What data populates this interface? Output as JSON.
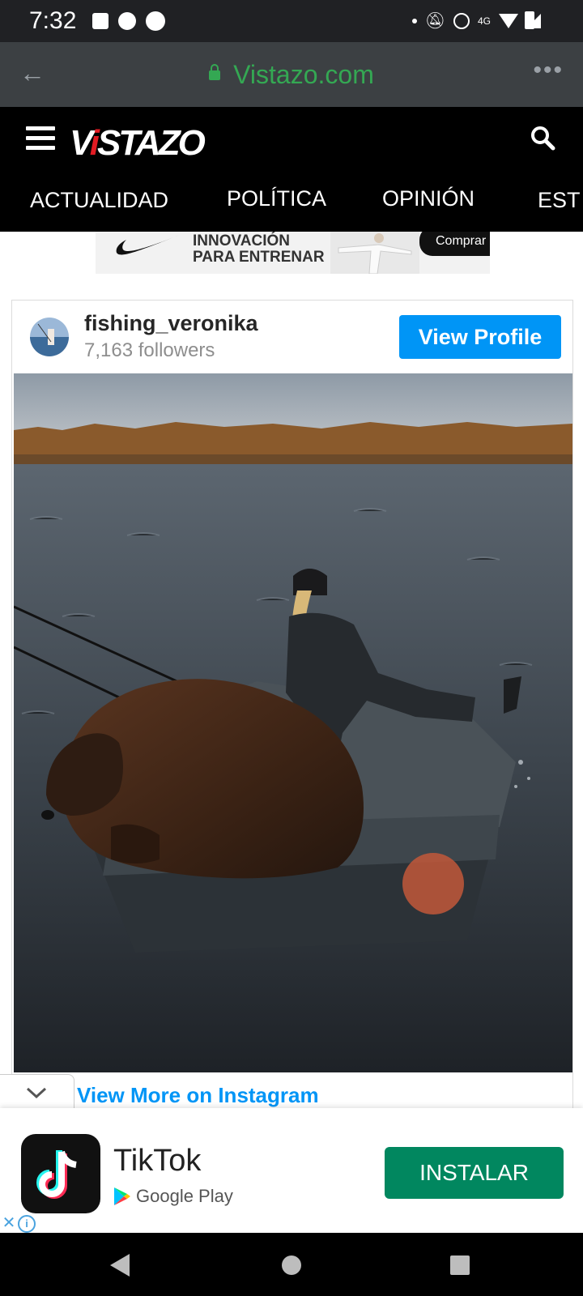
{
  "status_bar": {
    "time": "7:32",
    "network_label": "4G"
  },
  "url_bar": {
    "host": "Vistazo.com",
    "more_label": "•••"
  },
  "site": {
    "logo_text_before": "V",
    "logo_text_i": "i",
    "logo_text_after": "STAZO",
    "nav_tabs": [
      "ACTUALIDAD",
      "POLÍTICA",
      "OPINIÓN",
      "EST"
    ]
  },
  "banner_ad": {
    "line1": "INNOVACIÓN",
    "line2": "PARA ENTRENAR",
    "cta": "Comprar"
  },
  "instagram": {
    "username": "fishing_veronika",
    "followers": "7,163 followers",
    "view_profile_label": "View Profile",
    "view_more_label": "View More on Instagram"
  },
  "app_ad": {
    "app_name": "TikTok",
    "store": "Google Play",
    "install_label": "INSTALAR"
  },
  "colors": {
    "instagram_blue": "#0095f6",
    "install_green": "#01875f",
    "url_green": "#34a853",
    "logo_red": "#e21b23"
  },
  "icons": [
    "back-arrow-icon",
    "lock-icon",
    "more-icon",
    "hamburger-icon",
    "search-icon",
    "chevron-down-icon",
    "close-icon",
    "info-icon",
    "google-play-icon",
    "tiktok-icon"
  ]
}
